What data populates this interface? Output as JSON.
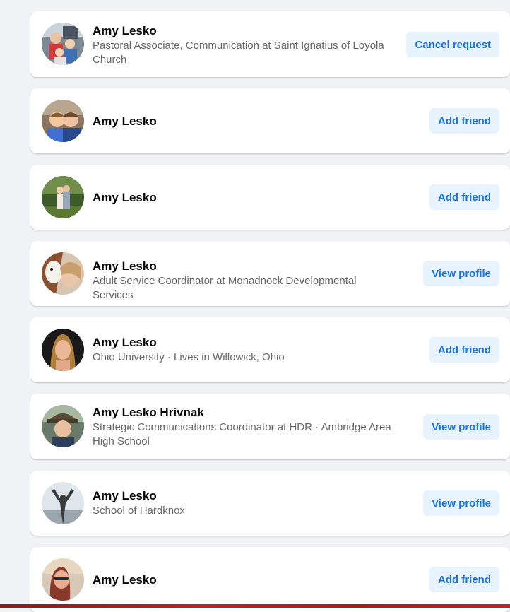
{
  "results": [
    {
      "name": "Amy Lesko",
      "subtitle": "Pastoral Associate, Communication at Saint Ignatius of Loyola Church",
      "action": "Cancel request"
    },
    {
      "name": "Amy Lesko",
      "subtitle": "",
      "action": "Add friend"
    },
    {
      "name": "Amy Lesko",
      "subtitle": "",
      "action": "Add friend"
    },
    {
      "name": "Amy Lesko",
      "subtitle": "Adult Service Coordinator at Monadnock Developmental Services",
      "action": "View profile"
    },
    {
      "name": "Amy Lesko",
      "subtitle": "Ohio University · Lives in Willowick, Ohio",
      "action": "Add friend"
    },
    {
      "name": "Amy Lesko Hrivnak",
      "subtitle": "Strategic Communications Coordinator at HDR · Ambridge Area High School",
      "action": "View profile"
    },
    {
      "name": "Amy Lesko",
      "subtitle": "School of Hardknox",
      "action": "View profile"
    },
    {
      "name": "Amy Lesko",
      "subtitle": "",
      "action": "Add friend"
    }
  ],
  "colors": {
    "page_background": "#f0f2f5",
    "card_background": "#ffffff",
    "button_background": "#e7f3ff",
    "button_text": "#1b74e4",
    "name_text": "#050505",
    "subtitle_text": "#65676b"
  }
}
